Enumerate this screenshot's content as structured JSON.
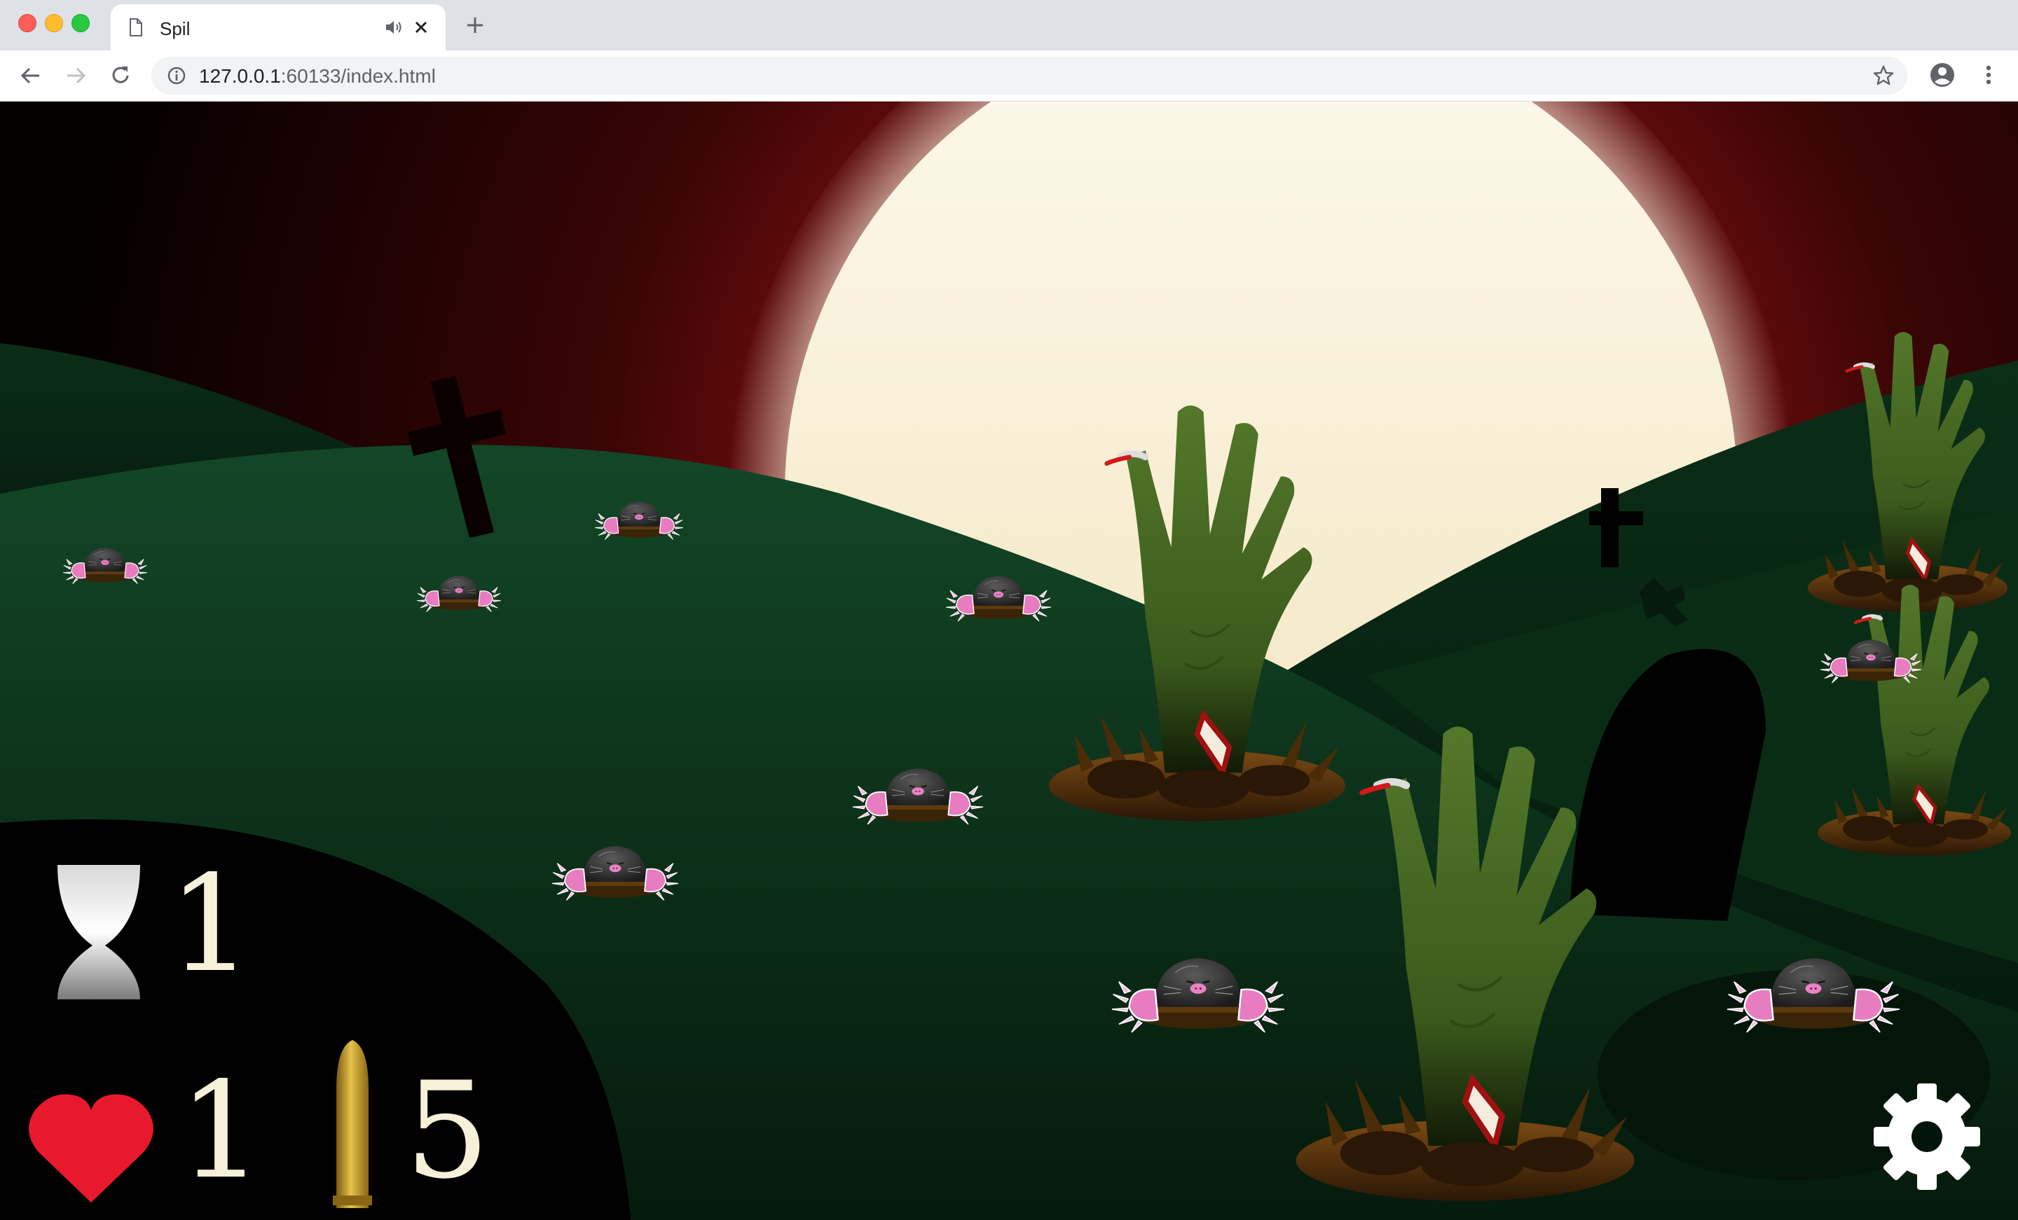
{
  "browser": {
    "tab_title": "Spil",
    "url_host": "127.0.0.1",
    "url_rest": ":60133/index.html"
  },
  "icons": {
    "tab": "page-icon",
    "audio": "speaker-icon",
    "close": "close-icon",
    "new_tab": "plus-icon",
    "back": "back-arrow-icon",
    "forward": "forward-arrow-icon",
    "reload": "reload-icon",
    "site_info": "info-icon",
    "bookmark": "star-icon",
    "profile": "account-icon",
    "menu": "kebab-menu-icon",
    "timer": "hourglass-icon",
    "lives": "heart-icon",
    "ammo": "bullet-icon",
    "settings": "gear-icon"
  },
  "hud": {
    "timer": "1",
    "lives": "1",
    "ammo": "5"
  },
  "colors": {
    "sky_top": "#050000",
    "sky_glow": "#8a1010",
    "moon": "#fbf6e4",
    "hills": "#0f3a1e",
    "zombie_hand": "#4a6e22",
    "mole_claw": "#e87cc0",
    "heart": "#e8192c",
    "bullet": "#c9a230",
    "hud_text": "#f7f1d9"
  }
}
